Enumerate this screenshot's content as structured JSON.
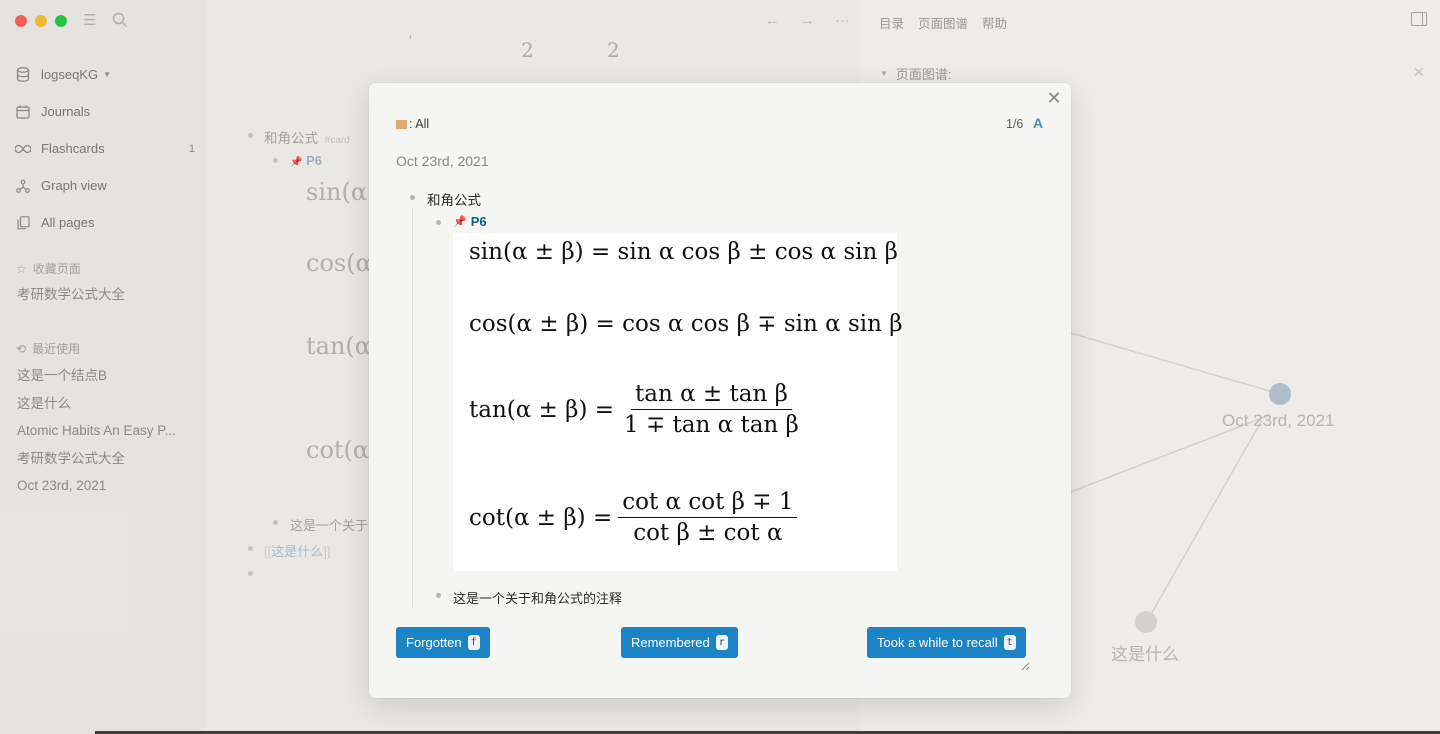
{
  "sidebar": {
    "graph_name": "logseqKG",
    "nav": [
      {
        "label": "Journals",
        "icon": "calendar-icon"
      },
      {
        "label": "Flashcards",
        "icon": "infinity-icon",
        "count": "1"
      },
      {
        "label": "Graph view",
        "icon": "graph-icon"
      },
      {
        "label": "All pages",
        "icon": "pages-icon"
      }
    ],
    "favorites_title": "收藏页面",
    "favorites": [
      "考研数学公式大全"
    ],
    "recent_title": "最近使用",
    "recent": [
      "这是一个结点B",
      "这是什么",
      "Atomic Habits An Easy P...",
      "考研数学公式大全",
      "Oct 23rd, 2021"
    ]
  },
  "background_page": {
    "digits": [
      "2",
      "2"
    ],
    "block_title": "和角公式",
    "tag": "#card",
    "p6": "P6",
    "formula_fragments": [
      "sin(α",
      "cos(α",
      "tan(α",
      "cot(α"
    ],
    "note": "这是一个关于",
    "link": "这是什么"
  },
  "right_panel": {
    "links": [
      "目录",
      "页面图谱",
      "帮助"
    ],
    "graph_title": "页面图谱:",
    "nodes": [
      "Oct 23rd, 2021",
      "这是什么"
    ]
  },
  "modal": {
    "deck": ": All",
    "progress": "1/6",
    "toggle": "A",
    "date": "Oct 23rd, 2021",
    "block_title": "和角公式",
    "p6": "P6",
    "note": "这是一个关于和角公式的注释",
    "formulas": {
      "sin_lhs": "sin(α ± β) = sin α cos β ± cos α sin β",
      "cos_lhs": "cos(α ± β) = cos α cos β ∓ sin α sin β",
      "tan_lhs": "tan(α ± β) =",
      "tan_num": "tan α ± tan β",
      "tan_den": "1 ∓ tan α tan β",
      "cot_lhs": "cot(α ± β) =",
      "cot_num": "cot α cot β ∓ 1",
      "cot_den": "cot β ± cot α"
    },
    "buttons": [
      {
        "label": "Forgotten",
        "key": "f"
      },
      {
        "label": "Remembered",
        "key": "r"
      },
      {
        "label": "Took a while to recall",
        "key": "t"
      }
    ]
  }
}
